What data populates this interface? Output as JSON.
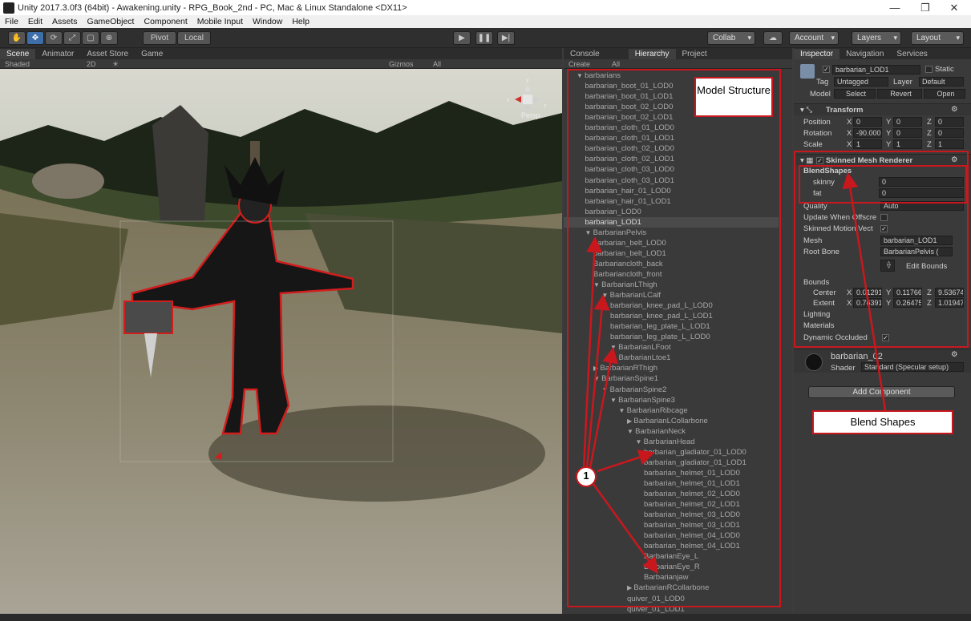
{
  "window": {
    "title": "Unity 2017.3.0f3 (64bit) - Awakening.unity - RPG_Book_2nd - PC, Mac & Linux Standalone <DX11>",
    "min": "—",
    "max": "❐",
    "close": "✕"
  },
  "menu": [
    "File",
    "Edit",
    "Assets",
    "GameObject",
    "Component",
    "Mobile Input",
    "Window",
    "Help"
  ],
  "toolbar": {
    "pivot": "Pivot",
    "local": "Local",
    "collab": "Collab",
    "account": "Account",
    "layers": "Layers",
    "layout": "Layout"
  },
  "scene": {
    "tabs": [
      "Scene",
      "Animator",
      "Asset Store",
      "Game"
    ],
    "shading": "Shaded",
    "mode2d": "2D",
    "gizmos": "Gizmos",
    "search": "All",
    "persp": "Persp"
  },
  "hierarchy": {
    "tabs": [
      "Console",
      "Hierarchy",
      "Project"
    ],
    "create": "Create",
    "search": "All",
    "items": [
      {
        "label": "barbarians",
        "indent": 0,
        "arrow": "▼"
      },
      {
        "label": "barbarian_boot_01_LOD0",
        "indent": 1
      },
      {
        "label": "barbarian_boot_01_LOD1",
        "indent": 1
      },
      {
        "label": "barbarian_boot_02_LOD0",
        "indent": 1
      },
      {
        "label": "barbarian_boot_02_LOD1",
        "indent": 1
      },
      {
        "label": "barbarian_cloth_01_LOD0",
        "indent": 1
      },
      {
        "label": "barbarian_cloth_01_LOD1",
        "indent": 1
      },
      {
        "label": "barbarian_cloth_02_LOD0",
        "indent": 1
      },
      {
        "label": "barbarian_cloth_02_LOD1",
        "indent": 1
      },
      {
        "label": "barbarian_cloth_03_LOD0",
        "indent": 1
      },
      {
        "label": "barbarian_cloth_03_LOD1",
        "indent": 1
      },
      {
        "label": "barbarian_hair_01_LOD0",
        "indent": 1
      },
      {
        "label": "barbarian_hair_01_LOD1",
        "indent": 1
      },
      {
        "label": "barbarian_LOD0",
        "indent": 1
      },
      {
        "label": "barbarian_LOD1",
        "indent": 1,
        "selected": true
      },
      {
        "label": "BarbarianPelvis",
        "indent": 1,
        "arrow": "▼"
      },
      {
        "label": "barbarian_belt_LOD0",
        "indent": 2
      },
      {
        "label": "barbarian_belt_LOD1",
        "indent": 2
      },
      {
        "label": "Barbariancloth_back",
        "indent": 2
      },
      {
        "label": "Barbariancloth_front",
        "indent": 2
      },
      {
        "label": "BarbarianLThigh",
        "indent": 2,
        "arrow": "▼"
      },
      {
        "label": "BarbarianLCalf",
        "indent": 3,
        "arrow": "▼"
      },
      {
        "label": "barbarian_knee_pad_L_LOD0",
        "indent": 4
      },
      {
        "label": "barbarian_knee_pad_L_LOD1",
        "indent": 4
      },
      {
        "label": "barbarian_leg_plate_L_LOD1",
        "indent": 4
      },
      {
        "label": "barbarian_leg_plate_L_LOD0",
        "indent": 4
      },
      {
        "label": "BarbarianLFoot",
        "indent": 4,
        "arrow": "▼"
      },
      {
        "label": "BarbarianLtoe1",
        "indent": 5
      },
      {
        "label": "BarbarianRThigh",
        "indent": 2,
        "arrow": "▶"
      },
      {
        "label": "BarbarianSpine1",
        "indent": 2,
        "arrow": "▼"
      },
      {
        "label": "BarbarianSpine2",
        "indent": 3,
        "arrow": "▼"
      },
      {
        "label": "BarbarianSpine3",
        "indent": 4,
        "arrow": "▼"
      },
      {
        "label": "BarbarianRibcage",
        "indent": 5,
        "arrow": "▼"
      },
      {
        "label": "BarbarianLCollarbone",
        "indent": 6,
        "arrow": "▶"
      },
      {
        "label": "BarbarianNeck",
        "indent": 6,
        "arrow": "▼"
      },
      {
        "label": "BarbarianHead",
        "indent": 7,
        "arrow": "▼"
      },
      {
        "label": "barbarian_gladiator_01_LOD0",
        "indent": 8
      },
      {
        "label": "barbarian_gladiator_01_LOD1",
        "indent": 8
      },
      {
        "label": "barbarian_helmet_01_LOD0",
        "indent": 8
      },
      {
        "label": "barbarian_helmet_01_LOD1",
        "indent": 8
      },
      {
        "label": "barbarian_helmet_02_LOD0",
        "indent": 8
      },
      {
        "label": "barbarian_helmet_02_LOD1",
        "indent": 8
      },
      {
        "label": "barbarian_helmet_03_LOD0",
        "indent": 8
      },
      {
        "label": "barbarian_helmet_03_LOD1",
        "indent": 8
      },
      {
        "label": "barbarian_helmet_04_LOD0",
        "indent": 8
      },
      {
        "label": "barbarian_helmet_04_LOD1",
        "indent": 8
      },
      {
        "label": "BarbarianEye_L",
        "indent": 8
      },
      {
        "label": "BarbarianEye_R",
        "indent": 8
      },
      {
        "label": "Barbarianjaw",
        "indent": 8
      },
      {
        "label": "BarbarianRCollarbone",
        "indent": 6,
        "arrow": "▶"
      },
      {
        "label": "quiver_01_LOD0",
        "indent": 6
      },
      {
        "label": "quiver_01_LOD1",
        "indent": 6
      }
    ]
  },
  "inspector": {
    "tabs": [
      "Inspector",
      "Navigation",
      "Services"
    ],
    "object_name": "barbarian_LOD1",
    "static": "Static",
    "tag_label": "Tag",
    "tag": "Untagged",
    "layer_label": "Layer",
    "layer": "Default",
    "model_label": "Model",
    "select": "Select",
    "revert": "Revert",
    "open": "Open",
    "transform": {
      "title": "Transform",
      "position_label": "Position",
      "position": [
        "0",
        "0",
        "0"
      ],
      "rotation_label": "Rotation",
      "rotation": [
        "-90.000",
        "0",
        "0"
      ],
      "scale_label": "Scale",
      "scale": [
        "1",
        "1",
        "1"
      ]
    },
    "smr": {
      "title": "Skinned Mesh Renderer",
      "blendshapes_label": "BlendShapes",
      "blendshapes": [
        {
          "name": "skinny",
          "value": "0"
        },
        {
          "name": "fat",
          "value": "0"
        }
      ],
      "quality_label": "Quality",
      "quality": "Auto",
      "update_offscreen": "Update When Offscre",
      "skinned_motion": "Skinned Motion Vect",
      "mesh_label": "Mesh",
      "mesh": "barbarian_LOD1",
      "root_bone_label": "Root Bone",
      "root_bone": "BarbarianPelvis (",
      "edit_bounds": "Edit Bounds",
      "bounds_label": "Bounds",
      "center_label": "Center",
      "center": [
        "0.01291",
        "0.11766",
        "9.53674"
      ],
      "extent_label": "Extent",
      "extent": [
        "0.76391",
        "0.26475",
        "1.01947"
      ],
      "lighting": "Lighting",
      "materials": "Materials",
      "dynamic_occluded": "Dynamic Occluded"
    },
    "material": {
      "name": "barbarian_02",
      "shader_label": "Shader",
      "shader": "Standard (Specular setup)"
    },
    "add_component": "Add Component"
  },
  "callouts": {
    "model_structure": "Model Structure",
    "blend_shapes": "Blend Shapes",
    "marker": "1"
  },
  "colors": {
    "accent_red": "#c8181e"
  }
}
